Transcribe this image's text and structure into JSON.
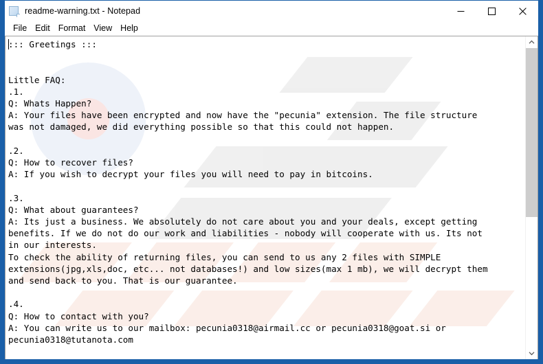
{
  "window": {
    "title": "readme-warning.txt - Notepad",
    "app_icon": "notepad-document-icon",
    "accent_color": "#1a5fa8",
    "controls": {
      "minimize": "minimize-icon",
      "maximize": "maximize-icon",
      "close": "close-icon"
    }
  },
  "menubar": {
    "items": [
      {
        "label": "File"
      },
      {
        "label": "Edit"
      },
      {
        "label": "Format"
      },
      {
        "label": "View"
      },
      {
        "label": "Help"
      }
    ]
  },
  "editor": {
    "text": "::: Greetings :::\n\n\nLittle FAQ:\n.1.\nQ: Whats Happen?\nA: Your files have been encrypted and now have the \"pecunia\" extension. The file structure\nwas not damaged, we did everything possible so that this could not happen.\n\n.2.\nQ: How to recover files?\nA: If you wish to decrypt your files you will need to pay in bitcoins.\n\n.3.\nQ: What about guarantees?\nA: Its just a business. We absolutely do not care about you and your deals, except getting\nbenefits. If we do not do our work and liabilities - nobody will cooperate with us. Its not\nin our interests.\nTo check the ability of returning files, you can send to us any 2 files with SIMPLE\nextensions(jpg,xls,doc, etc... not databases!) and low sizes(max 1 mb), we will decrypt them\nand send back to you. That is our guarantee.\n\n.4.\nQ: How to contact with you?\nA: You can write us to our mailbox: pecunia0318@airmail.cc or pecunia0318@goat.si or\npecunia0318@tutanota.com",
    "file_extension": "pecunia",
    "contacts": [
      "pecunia0318@airmail.cc",
      "pecunia0318@goat.si",
      "pecunia0318@tutanota.com"
    ]
  },
  "scrollbar": {
    "up_arrow": "chevron-up-icon",
    "down_arrow": "chevron-down-icon",
    "thumb_color": "#cdcdcd"
  }
}
